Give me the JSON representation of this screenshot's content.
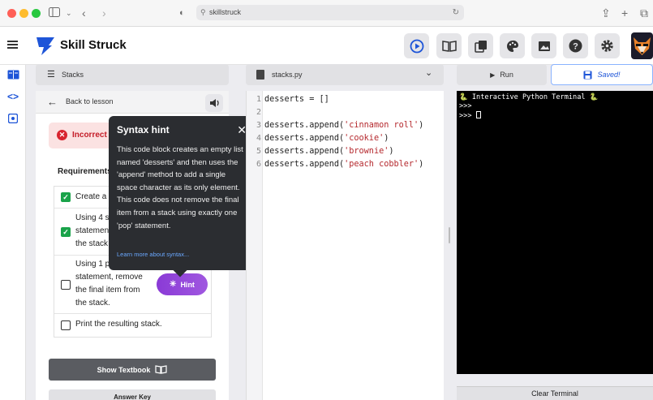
{
  "browser": {
    "url": "skillstruck"
  },
  "app": {
    "brand": "Skill Struck",
    "colors": {
      "accent": "#1e55d8",
      "error": "#d8242f",
      "success": "#1aa34a",
      "hint": "#9147d9"
    }
  },
  "toolbar": {
    "icons": [
      "play-circle-icon",
      "book-open-icon",
      "stack-icon",
      "palette-icon",
      "image-icon",
      "help-icon",
      "gear-icon"
    ]
  },
  "panels": {
    "stacks_label": "Stacks",
    "file_label": "stacks.py"
  },
  "lesson": {
    "back_label": "Back to lesson",
    "status_label": "Incorrect",
    "requirements_title": "Requirements",
    "requirements": [
      {
        "lines": [
          "Create a"
        ],
        "checked": true
      },
      {
        "lines": [
          "Using 4 s",
          "statement",
          "the stack"
        ],
        "checked": true
      },
      {
        "lines": [
          "Using 1 p",
          "statement, remove",
          "the final item from",
          "the stack."
        ],
        "checked": false
      },
      {
        "lines": [
          "Print the resulting stack."
        ],
        "checked": false
      }
    ],
    "hint_label": "Hint",
    "textbook_label": "Show Textbook",
    "answer_label": "Answer Key"
  },
  "tooltip": {
    "title": "Syntax hint",
    "body": "This code block creates an empty list named 'desserts' and then uses the 'append' method to add a single space character as its only element. This code does not remove the final item from a stack using exactly one 'pop' statement.",
    "link": "Learn more about syntax..."
  },
  "editor": {
    "lines": [
      {
        "n": "1",
        "pre": "desserts = []",
        "str": "",
        "post": ""
      },
      {
        "n": "2",
        "pre": "",
        "str": "",
        "post": ""
      },
      {
        "n": "3",
        "pre": "desserts.append(",
        "str": "'cinnamon roll'",
        "post": ")"
      },
      {
        "n": "4",
        "pre": "desserts.append(",
        "str": "'cookie'",
        "post": ")"
      },
      {
        "n": "5",
        "pre": "desserts.append(",
        "str": "'brownie'",
        "post": ")"
      },
      {
        "n": "6",
        "pre": "desserts.append(",
        "str": "'peach cobbler'",
        "post": ")"
      }
    ]
  },
  "terminal": {
    "run_label": "Run",
    "saved_label": "Saved!",
    "banner": "🐍 Interactive Python Terminal 🐍",
    "prompt1": ">>>",
    "prompt2": ">>> ",
    "clear_label": "Clear Terminal"
  }
}
